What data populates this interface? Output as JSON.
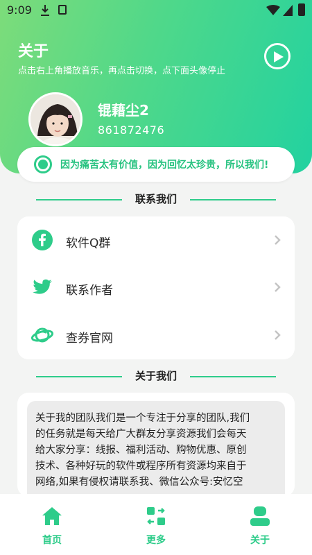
{
  "status": {
    "time": "9:09"
  },
  "header": {
    "title": "关于",
    "subtitle": "点击右上角播放音乐，再点击切换，点下面头像停止"
  },
  "user": {
    "name": "锟藉尘2",
    "id": "861872476"
  },
  "notice": {
    "text": "因为痛苦太有价值，因为回忆太珍贵，所以我们!"
  },
  "contact": {
    "title": "联系我们",
    "items": [
      {
        "label": "软件Q群",
        "icon": "facebook-icon"
      },
      {
        "label": "联系作者",
        "icon": "twitter-icon"
      },
      {
        "label": "查券官网",
        "icon": "planet-icon"
      }
    ]
  },
  "about": {
    "title": "关于我们",
    "lines": [
      "关于我的团队我们是一个专注于分享的团队,我们",
      "的任务就是每天给广大群友分享资源我们会每天",
      "给大家分享：线报、福利活动、购物优惠、原创",
      "技术、各种好玩的软件或程序所有资源均来自于",
      "网络,如果有侵权请联系我、微信公众号:安忆空"
    ]
  },
  "tabs": [
    {
      "label": "首页",
      "icon": "home-icon"
    },
    {
      "label": "更多",
      "icon": "apps-icon"
    },
    {
      "label": "关于",
      "icon": "user-icon"
    }
  ],
  "colors": {
    "accent": "#2ecc8a",
    "header_start": "#7ddc7a",
    "header_end": "#22d2a0"
  }
}
